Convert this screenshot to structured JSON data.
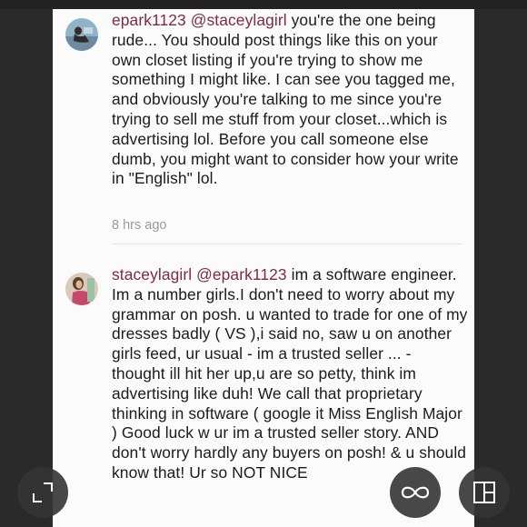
{
  "comments": [
    {
      "username": "epark1123",
      "mention": "@staceylagirl",
      "text": "you're the one being rude... You should post things like this on your own closet listing if you're trying to show me something I might like. I can see you tagged me, and obviously you're talking to me since you're trying to sell me stuff from your closet...which is advertising lol. Before you call someone else dumb, you might want to consider how your write in \"English\" lol.",
      "time": "8 hrs ago"
    },
    {
      "username": "staceylagirl",
      "mention": "@epark1123",
      "text": "im a software engineer. Im a number girls.I don't need to worry about my grammar on posh. u wanted to trade for one of my dresses badly ( VS ),i said no, saw u on another girls feed, ur usual - im a trusted seller ... - thought ill hit her up,u are so petty, think im advertising like duh! We call that proprietary thinking in software ( google it Miss English Major ) Good luck w ur im a trusted seller story. AND don't worry hardly any buyers on posh! & u should know that! Ur so NOT NICE"
    }
  ],
  "icons": {
    "expand": "expand-icon",
    "loop": "infinity-icon",
    "layout": "layout-icon"
  },
  "colors": {
    "username": "#7e2b3e",
    "background": "#2a2a2a",
    "card": "#fbfbfb"
  }
}
